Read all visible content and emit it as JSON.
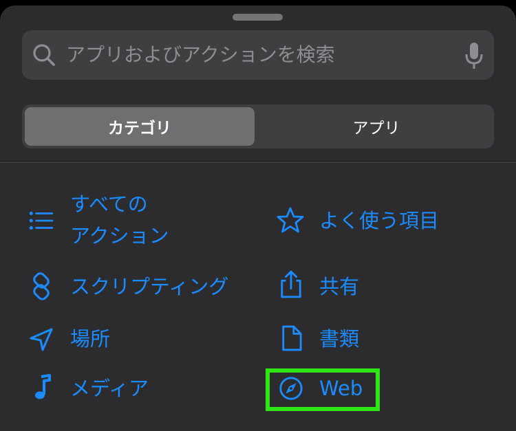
{
  "search": {
    "placeholder": "アプリおよびアクションを検索"
  },
  "segmented": {
    "tabs": [
      {
        "label": "カテゴリ",
        "selected": true
      },
      {
        "label": "アプリ",
        "selected": false
      }
    ]
  },
  "categories": {
    "left": [
      {
        "label_line1": "すべての",
        "label_line2": "アクション",
        "icon": "list-icon"
      },
      {
        "label": "スクリプティング",
        "icon": "scripting-icon"
      },
      {
        "label": "場所",
        "icon": "location-arrow-icon"
      },
      {
        "label": "メディア",
        "icon": "music-note-icon"
      }
    ],
    "right": [
      {
        "label": "よく使う項目",
        "icon": "star-icon"
      },
      {
        "label": "共有",
        "icon": "share-icon"
      },
      {
        "label": "書類",
        "icon": "document-icon"
      },
      {
        "label": "Web",
        "icon": "compass-icon",
        "highlighted": true
      }
    ]
  },
  "colors": {
    "accent": "#1a8cff",
    "highlight": "#2ee614",
    "sheet": "#2c2c2e"
  }
}
